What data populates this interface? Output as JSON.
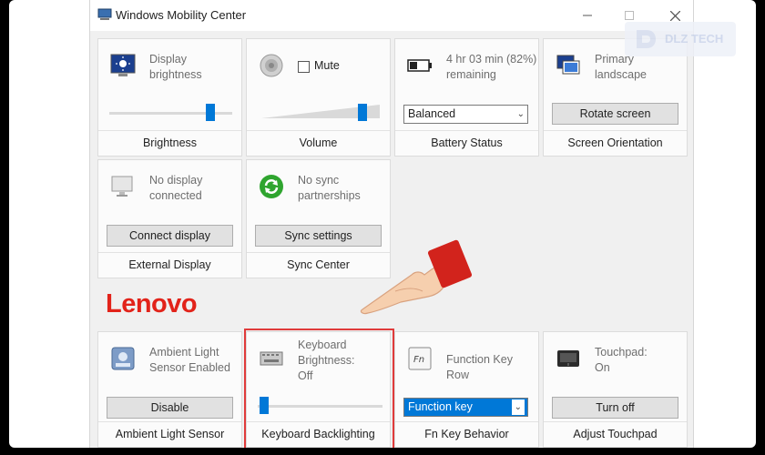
{
  "window": {
    "title": "Windows Mobility Center"
  },
  "watermark": {
    "text": "DLZ TECH"
  },
  "tiles": {
    "brightness": {
      "line1": "Display",
      "line2": "brightness",
      "footer": "Brightness",
      "level": 0.85
    },
    "volume": {
      "checkbox_label": "Mute",
      "checked": false,
      "footer": "Volume",
      "level": 0.85
    },
    "battery": {
      "line1": "4 hr 03 min (82%)",
      "line2": "remaining",
      "select_value": "Balanced",
      "footer": "Battery Status",
      "charge_percent": 82
    },
    "orientation": {
      "line1": "Primary",
      "line2": "landscape",
      "button": "Rotate screen",
      "footer": "Screen Orientation"
    },
    "display": {
      "line1": "No display",
      "line2": "connected",
      "button": "Connect display",
      "footer": "External Display"
    },
    "sync": {
      "line1": "No sync",
      "line2": "partnerships",
      "button": "Sync settings",
      "footer": "Sync Center"
    },
    "ambient": {
      "line1": "Ambient Light",
      "line2": "Sensor Enabled",
      "button": "Disable",
      "footer": "Ambient Light Sensor"
    },
    "keyboard": {
      "line1": "Keyboard",
      "line2": "Brightness:",
      "line3": "Off",
      "footer": "Keyboard Backlighting",
      "level": 0.0
    },
    "fnkey": {
      "line1": "Function Key Row",
      "select_value": "Function key",
      "footer": "Fn Key Behavior"
    },
    "touchpad": {
      "line1": "Touchpad:",
      "line2": "On",
      "button": "Turn off",
      "footer": "Adjust Touchpad"
    }
  },
  "brand": {
    "name": "Lenovo"
  },
  "colors": {
    "accent": "#0078d7",
    "brand": "#e2231a",
    "highlight": "#e03b3b",
    "cuff": "#d2231c"
  }
}
